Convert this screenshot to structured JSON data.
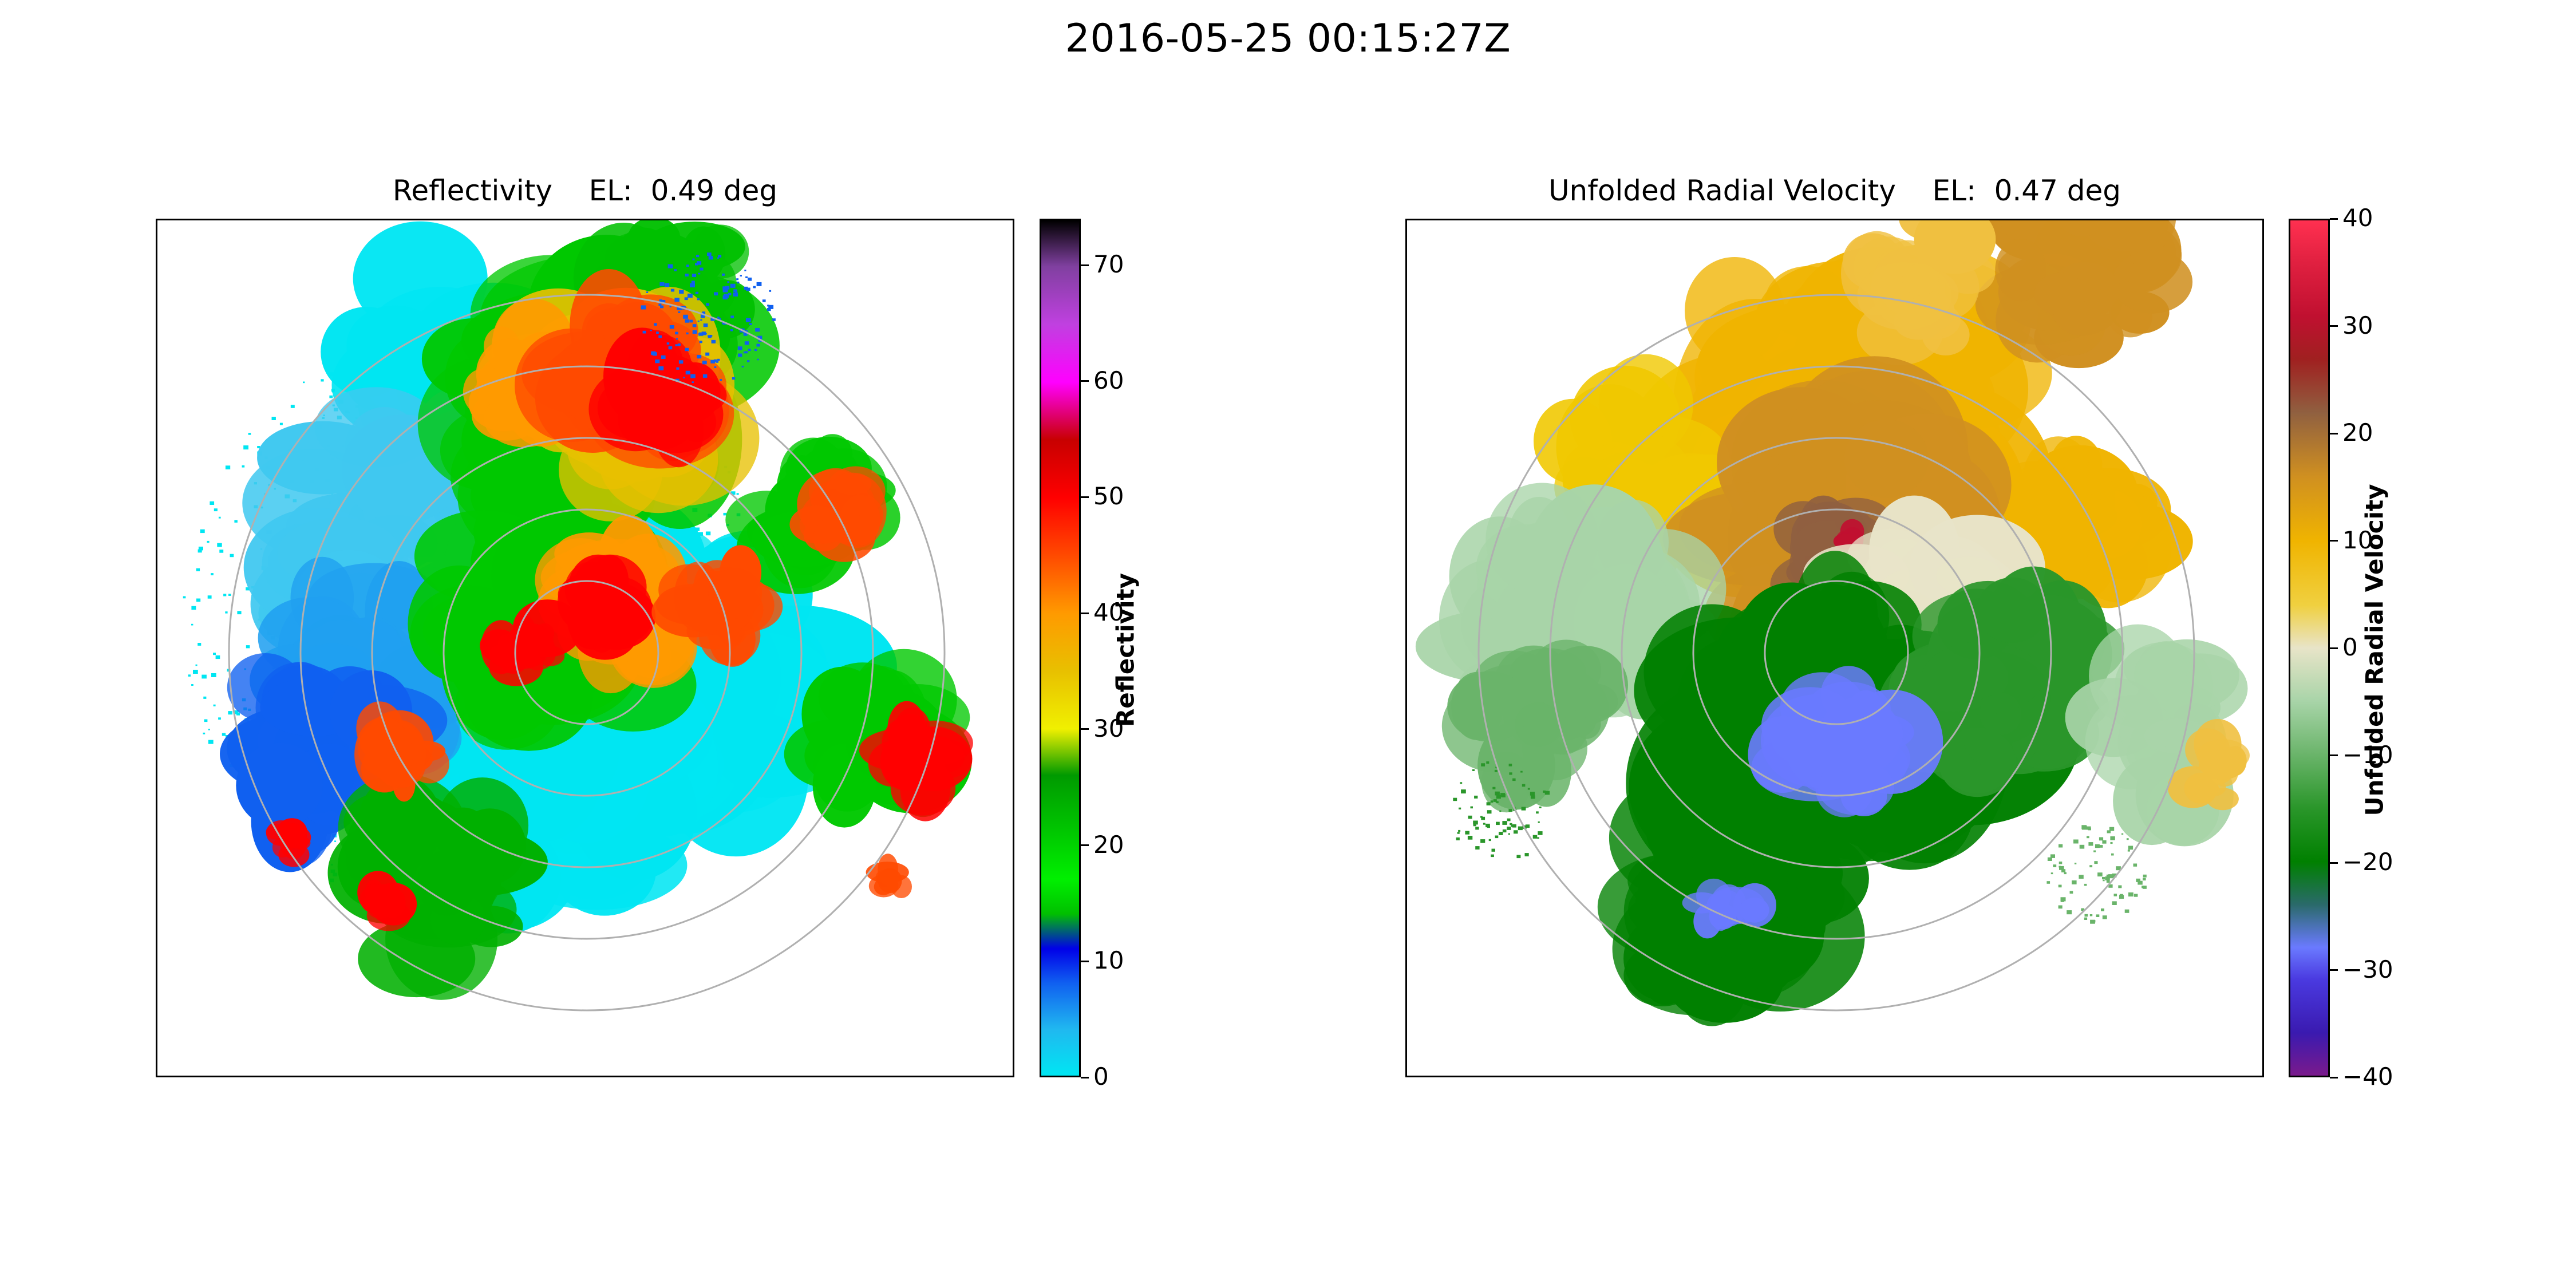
{
  "figure": {
    "suptitle": "2016-05-25 00:15:27Z"
  },
  "panels": [
    {
      "id": "reflectivity",
      "title": "Reflectivity    EL:  0.49 deg",
      "colorbar": {
        "label": "Reflectivity",
        "range": [
          0,
          74
        ],
        "ticks": [
          "0",
          "10",
          "20",
          "30",
          "40",
          "50",
          "60",
          "70"
        ],
        "tick_values": [
          0,
          10,
          20,
          30,
          40,
          50,
          60,
          70
        ],
        "colormap": "NWSRef",
        "stops": [
          {
            "v": 0,
            "c": "#00e6f2"
          },
          {
            "v": 4,
            "c": "#20b8f0"
          },
          {
            "v": 8,
            "c": "#1060f0"
          },
          {
            "v": 11,
            "c": "#0000e8"
          },
          {
            "v": 14,
            "c": "#00c000"
          },
          {
            "v": 17,
            "c": "#00f000"
          },
          {
            "v": 21,
            "c": "#00c800"
          },
          {
            "v": 26,
            "c": "#009a00"
          },
          {
            "v": 30,
            "c": "#f0f000"
          },
          {
            "v": 35,
            "c": "#e8c000"
          },
          {
            "v": 40,
            "c": "#ff9a00"
          },
          {
            "v": 45,
            "c": "#ff4a00"
          },
          {
            "v": 50,
            "c": "#ff0000"
          },
          {
            "v": 55,
            "c": "#c80000"
          },
          {
            "v": 60,
            "c": "#ff00ff"
          },
          {
            "v": 65,
            "c": "#c040e0"
          },
          {
            "v": 70,
            "c": "#8040a0"
          },
          {
            "v": 74,
            "c": "#000000"
          }
        ]
      }
    },
    {
      "id": "velocity",
      "title": "Unfolded Radial Velocity    EL:  0.47 deg",
      "colorbar": {
        "label": "Unfolded Radial Velocity",
        "range": [
          -40,
          40
        ],
        "ticks": [
          "−40",
          "−30",
          "−20",
          "−10",
          "0",
          "10",
          "20",
          "30",
          "40"
        ],
        "tick_values": [
          -40,
          -30,
          -20,
          -10,
          0,
          10,
          20,
          30,
          40
        ],
        "colormap": "BuDRd18-like",
        "stops": [
          {
            "v": -40,
            "c": "#7a1a8c"
          },
          {
            "v": -36,
            "c": "#3a1ab0"
          },
          {
            "v": -31,
            "c": "#4a3ae0"
          },
          {
            "v": -28,
            "c": "#6a7aff"
          },
          {
            "v": -24,
            "c": "#2a6a6a"
          },
          {
            "v": -20,
            "c": "#008000"
          },
          {
            "v": -15,
            "c": "#2a962a"
          },
          {
            "v": -10,
            "c": "#6ab46a"
          },
          {
            "v": -5,
            "c": "#a8d4a8"
          },
          {
            "v": 0,
            "c": "#e8e4c8"
          },
          {
            "v": 4,
            "c": "#f0d040"
          },
          {
            "v": 10,
            "c": "#f0b400"
          },
          {
            "v": 16,
            "c": "#d09020"
          },
          {
            "v": 22,
            "c": "#906040"
          },
          {
            "v": 27,
            "c": "#a02020"
          },
          {
            "v": 31,
            "c": "#c01030"
          },
          {
            "v": 36,
            "c": "#e02040"
          },
          {
            "v": 40,
            "c": "#ff3050"
          }
        ]
      }
    }
  ]
}
